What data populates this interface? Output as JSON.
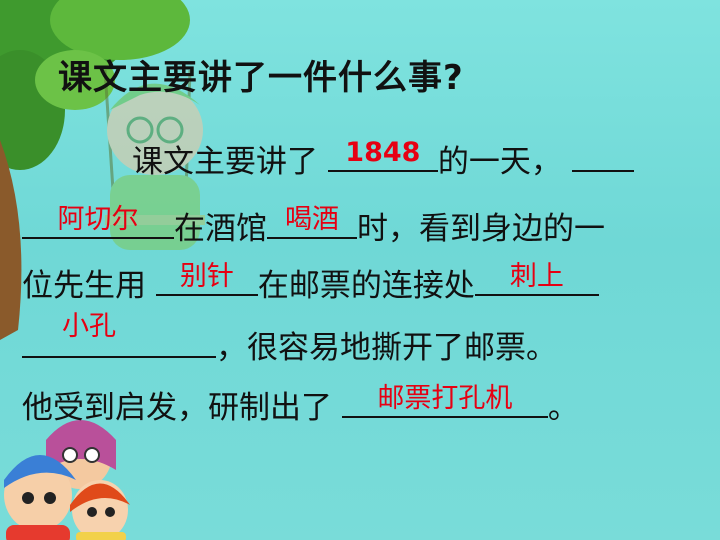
{
  "title": "课文主要讲了一件什么事?",
  "passage": {
    "l1_text1": "课文主要讲了",
    "l1_text2": "的一天，",
    "l2_text1": "在酒馆",
    "l2_text2": "时，看到身边的一",
    "l3_text1": "位先生用",
    "l3_text2": "在邮票的连接处",
    "l4_text1": "，很容易地撕开了邮票。",
    "l5_text1": "他受到启发，研制出了",
    "l5_text2": "。"
  },
  "answers": {
    "year": "1848",
    "place": "阿切尔",
    "action": "喝酒",
    "tool": "别针",
    "pierce": "刺上",
    "holes": "小孔",
    "invention": "邮票打孔机"
  }
}
